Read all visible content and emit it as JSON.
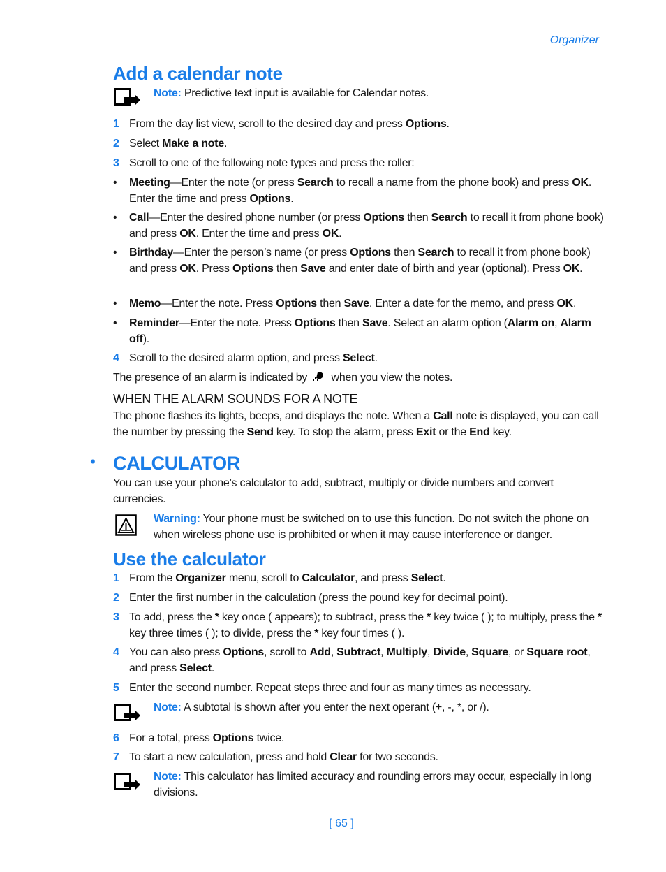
{
  "header": {
    "running_title": "Organizer"
  },
  "section1": {
    "title": "Add a calendar note",
    "note": {
      "icon": "note-icon",
      "label": "Note:",
      "text": " Predictive text input is available for Calendar notes."
    },
    "steps": [
      {
        "num": "1",
        "parts": [
          "From the day list view, scroll to the desired day and press ",
          "Options",
          "."
        ]
      },
      {
        "num": "2",
        "parts": [
          "Select ",
          "Make a note",
          "."
        ]
      },
      {
        "num": "3",
        "parts": [
          "Scroll to one of the following note types and press the roller:"
        ]
      }
    ],
    "bullets": [
      {
        "bullet": "•",
        "parts": [
          "Meeting",
          "—Enter the note (or press ",
          "Search",
          " to recall a name from the phone book) and press ",
          "OK",
          ". Enter the time and press ",
          "Options",
          "."
        ]
      },
      {
        "bullet": "•",
        "parts": [
          "Call",
          "—Enter the desired phone number (or press ",
          "Options",
          " then ",
          "Search",
          " to recall it from phone book) and press ",
          "OK",
          ". Enter the time and press ",
          "OK",
          "."
        ]
      },
      {
        "bullet": "•",
        "parts": [
          "Birthday",
          "—Enter the person’s name (or press ",
          "Options",
          " then ",
          "Search",
          " to recall it from phone book) and press ",
          "OK",
          ". Press ",
          "Options",
          " then ",
          "Save",
          " and enter date of birth and year (optional). Press ",
          "OK",
          "."
        ]
      },
      {
        "bullet": "•",
        "parts": [
          "Memo",
          "—Enter the note. Press ",
          "Options",
          " then ",
          "Save",
          ". Enter a date for the memo, and press ",
          "OK",
          "."
        ]
      },
      {
        "bullet": "•",
        "parts": [
          "Reminder",
          "—Enter the note. Press ",
          "Options",
          " then ",
          "Save",
          ". Select an alarm option (",
          "Alarm on",
          ", ",
          "Alarm off",
          ")."
        ]
      }
    ],
    "step4": {
      "num": "4",
      "parts": [
        "Scroll to the desired alarm option, and press ",
        "Select",
        "."
      ]
    },
    "alarm_indicator": {
      "before": "The presence of an alarm is indicated by ",
      "icon": "alarm-icon",
      "after": " when you view the notes."
    },
    "subsection": {
      "title": "WHEN THE ALARM SOUNDS FOR A NOTE",
      "parts": [
        "The phone flashes its lights, beeps, and displays the note. When a ",
        "Call",
        " note is displayed, you can call the number by pressing the ",
        "Send",
        " key. To stop the alarm, press ",
        "Exit",
        " or the ",
        "End",
        " key."
      ]
    }
  },
  "section2": {
    "bullet": "•",
    "title": "CALCULATOR",
    "intro": "You can use your phone’s calculator to add, subtract, multiply or divide numbers and convert currencies.",
    "warning": {
      "icon": "warning-icon",
      "label": "Warning:",
      "text": " Your phone must be switched on to use this function. Do not switch the phone on when wireless phone use is prohibited or when it may cause interference or danger."
    },
    "subtitle": "Use the calculator",
    "steps": [
      {
        "num": "1",
        "parts": [
          "From the ",
          "Organizer",
          " menu, scroll to ",
          "Calculator",
          ", and press ",
          "Select",
          "."
        ]
      },
      {
        "num": "2",
        "parts": [
          "Enter the first number in the calculation (press the pound key for decimal point)."
        ]
      },
      {
        "num": "3",
        "parts": [
          "To add, press the ",
          "*",
          " key once (    appears); to subtract, press the ",
          "*",
          " key twice (     ); to multiply, press the ",
          "*",
          " key three times (     ); to divide, press the ",
          "*",
          " key four times (     )."
        ]
      },
      {
        "num": "4",
        "parts": [
          "You can also press ",
          "Options",
          ", scroll to ",
          "Add",
          ", ",
          "Subtract",
          ", ",
          "Multiply",
          ", ",
          "Divide",
          ", ",
          "Square",
          ", or ",
          "Square root",
          ", and press ",
          "Select",
          "."
        ]
      },
      {
        "num": "5",
        "parts": [
          "Enter the second number. Repeat steps three and four as many times as necessary."
        ]
      }
    ],
    "note1": {
      "icon": "note-icon",
      "label": "Note:",
      "text": " A subtotal is shown after you enter the next operant (+, -, *, or /)."
    },
    "steps2": [
      {
        "num": "6",
        "parts": [
          "For a total, press ",
          "Options",
          " twice."
        ]
      },
      {
        "num": "7",
        "parts": [
          "To start a new calculation, press and hold ",
          "Clear",
          " for two seconds."
        ]
      }
    ],
    "note2": {
      "icon": "note-icon",
      "label": "Note:",
      "text": " This calculator has limited accuracy and rounding errors may occur, especially in long divisions."
    }
  },
  "footer": {
    "page_number": "[ 65 ]"
  }
}
